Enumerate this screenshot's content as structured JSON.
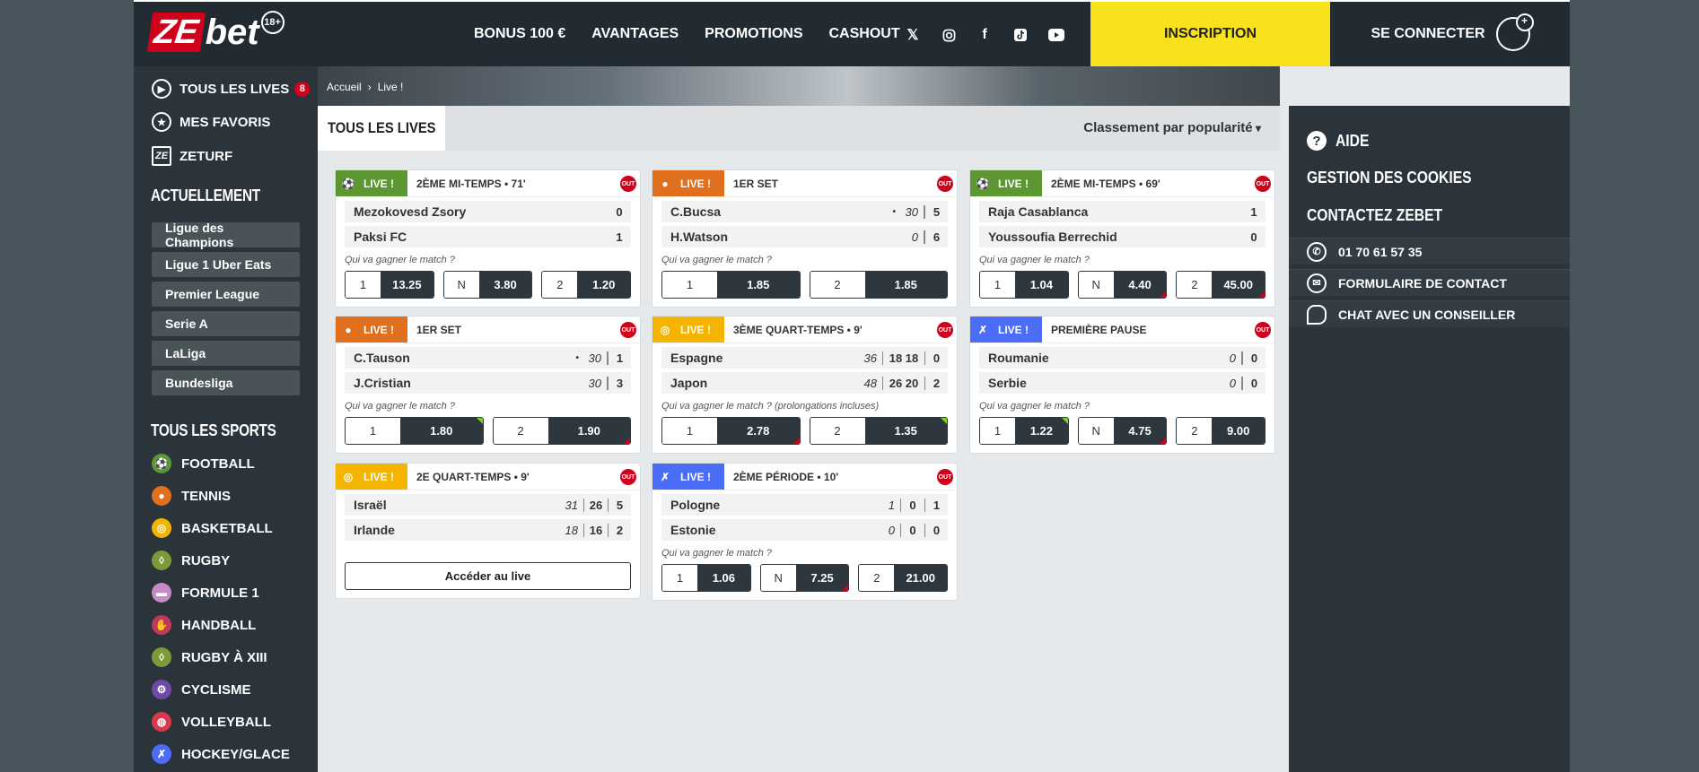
{
  "header": {
    "logo": {
      "ze": "ZE",
      "bet": "bet",
      "age": "18+"
    },
    "nav": [
      "BONUS 100 €",
      "AVANTAGES",
      "PROMOTIONS",
      "CASHOUT"
    ],
    "social_icons": [
      "x-icon",
      "instagram-icon",
      "facebook-icon",
      "tiktok-icon",
      "youtube-icon"
    ],
    "signup_label": "INSCRIPTION",
    "login_label": "SE CONNECTER"
  },
  "sidebar": {
    "all_lives": {
      "label": "TOUS LES LIVES",
      "count": "8"
    },
    "favorites": "MES FAVORIS",
    "zeturf": "ZETURF",
    "currently_title": "ACTUELLEMENT",
    "competitions": [
      "Ligue des Champions",
      "Ligue 1 Uber Eats",
      "Premier League",
      "Serie A",
      "LaLiga",
      "Bundesliga"
    ],
    "sports_title": "TOUS LES SPORTS",
    "sports": [
      {
        "label": "FOOTBALL",
        "color": "#5d9732",
        "icon": "football-icon"
      },
      {
        "label": "TENNIS",
        "color": "#e0701e",
        "icon": "tennis-icon"
      },
      {
        "label": "BASKETBALL",
        "color": "#f4b400",
        "icon": "basketball-icon"
      },
      {
        "label": "RUGBY",
        "color": "#7b9a3a",
        "icon": "rugby-icon"
      },
      {
        "label": "FORMULE 1",
        "color": "#c58bc7",
        "icon": "formula1-icon"
      },
      {
        "label": "HANDBALL",
        "color": "#c0395b",
        "icon": "handball-icon"
      },
      {
        "label": "RUGBY À XIII",
        "color": "#7b9a3a",
        "icon": "rugby-xiii-icon"
      },
      {
        "label": "CYCLISME",
        "color": "#6e4aa8",
        "icon": "cycling-icon"
      },
      {
        "label": "VOLLEYBALL",
        "color": "#d9394a",
        "icon": "volleyball-icon"
      },
      {
        "label": "HOCKEY/GLACE",
        "color": "#4a6cf7",
        "icon": "hockey-icon"
      }
    ]
  },
  "breadcrumb": {
    "home": "Accueil",
    "sep": "›",
    "current": "Live !"
  },
  "main": {
    "tab_label": "TOUS LES LIVES",
    "sort_label": "Classement par popularité",
    "question": "Qui va gagner le match ?",
    "question_ot": "Qui va gagner le match ? (prolongations incluses)",
    "live_label": "LIVE !",
    "access_live_label": "Accéder au live"
  },
  "matches": [
    {
      "sport": "football",
      "color": "#5d9732",
      "status": "2ÈME MI-TEMPS • 71'",
      "teams": [
        {
          "name": "Mezokovesd Zsory",
          "score": "0"
        },
        {
          "name": "Paksi FC",
          "score": "1"
        }
      ],
      "odds": [
        {
          "label": "1",
          "value": "13.25",
          "trend": ""
        },
        {
          "label": "N",
          "value": "3.80",
          "trend": ""
        },
        {
          "label": "2",
          "value": "1.20",
          "trend": ""
        }
      ]
    },
    {
      "sport": "tennis",
      "color": "#e0701e",
      "status": "1ER SET",
      "teams": [
        {
          "name": "C.Bucsa",
          "serve": "•",
          "points": "30",
          "score": "5"
        },
        {
          "name": "H.Watson",
          "serve": "",
          "points": "0",
          "score": "6"
        }
      ],
      "odds": [
        {
          "label": "1",
          "value": "1.85",
          "trend": ""
        },
        {
          "label": "2",
          "value": "1.85",
          "trend": ""
        }
      ]
    },
    {
      "sport": "football",
      "color": "#5d9732",
      "status": "2ÈME MI-TEMPS • 69'",
      "teams": [
        {
          "name": "Raja Casablanca",
          "score": "1"
        },
        {
          "name": "Youssoufia Berrechid",
          "score": "0"
        }
      ],
      "odds": [
        {
          "label": "1",
          "value": "1.04",
          "trend": ""
        },
        {
          "label": "N",
          "value": "4.40",
          "trend": "down"
        },
        {
          "label": "2",
          "value": "45.00",
          "trend": "down"
        }
      ]
    },
    {
      "sport": "tennis",
      "color": "#e0701e",
      "status": "1ER SET",
      "teams": [
        {
          "name": "C.Tauson",
          "serve": "•",
          "points": "30",
          "score": "1"
        },
        {
          "name": "J.Cristian",
          "serve": "",
          "points": "30",
          "score": "3"
        }
      ],
      "odds": [
        {
          "label": "1",
          "value": "1.80",
          "trend": "up"
        },
        {
          "label": "2",
          "value": "1.90",
          "trend": "down"
        }
      ]
    },
    {
      "sport": "basketball",
      "color": "#f4b400",
      "status": "3ÈME QUART-TEMPS • 9'",
      "teams": [
        {
          "name": "Espagne",
          "current": "36",
          "periods": "18 18",
          "score": "0"
        },
        {
          "name": "Japon",
          "current": "48",
          "periods": "26 20",
          "score": "2"
        }
      ],
      "odds": [
        {
          "label": "1",
          "value": "2.78",
          "trend": "down"
        },
        {
          "label": "2",
          "value": "1.35",
          "trend": "up"
        }
      ]
    },
    {
      "sport": "handball",
      "color": "#4a6cf7",
      "status": "PREMIÈRE PAUSE",
      "teams": [
        {
          "name": "Roumanie",
          "current": "0",
          "score": "0"
        },
        {
          "name": "Serbie",
          "current": "0",
          "score": "0"
        }
      ],
      "odds": [
        {
          "label": "1",
          "value": "1.22",
          "trend": "up"
        },
        {
          "label": "N",
          "value": "4.75",
          "trend": "down"
        },
        {
          "label": "2",
          "value": "9.00",
          "trend": ""
        }
      ]
    },
    {
      "sport": "basketball",
      "color": "#f4b400",
      "status": "2E QUART-TEMPS • 9'",
      "teams": [
        {
          "name": "Israël",
          "current": "31",
          "periods": "26",
          "score": "5"
        },
        {
          "name": "Irlande",
          "current": "18",
          "periods": "16",
          "score": "2"
        }
      ],
      "odds": []
    },
    {
      "sport": "handball",
      "color": "#4a6cf7",
      "status": "2ÈME PÉRIODE • 10'",
      "teams": [
        {
          "name": "Pologne",
          "current": "1",
          "periods": "0",
          "score": "1"
        },
        {
          "name": "Estonie",
          "current": "0",
          "periods": "0",
          "score": "0"
        }
      ],
      "odds": [
        {
          "label": "1",
          "value": "1.06",
          "trend": ""
        },
        {
          "label": "N",
          "value": "7.25",
          "trend": "down"
        },
        {
          "label": "2",
          "value": "21.00",
          "trend": ""
        }
      ]
    }
  ],
  "right": {
    "help": "AIDE",
    "cookies": "GESTION DES COOKIES",
    "contact_title": "CONTACTEZ ZEBET",
    "phone": "01 70 61 57 35",
    "form": "FORMULAIRE DE CONTACT",
    "chat": "CHAT AVEC UN CONSEILLER"
  }
}
